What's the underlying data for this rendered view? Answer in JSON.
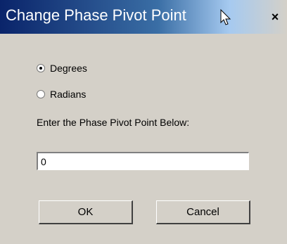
{
  "window": {
    "title": "Change Phase Pivot Point",
    "close_label": "×"
  },
  "units": {
    "options": [
      {
        "label": "Degrees",
        "selected": true
      },
      {
        "label": "Radians",
        "selected": false
      }
    ]
  },
  "prompt": "Enter the Phase Pivot Point Below:",
  "pivot_input": {
    "value": "0"
  },
  "buttons": {
    "ok_label": "OK",
    "cancel_label": "Cancel"
  }
}
